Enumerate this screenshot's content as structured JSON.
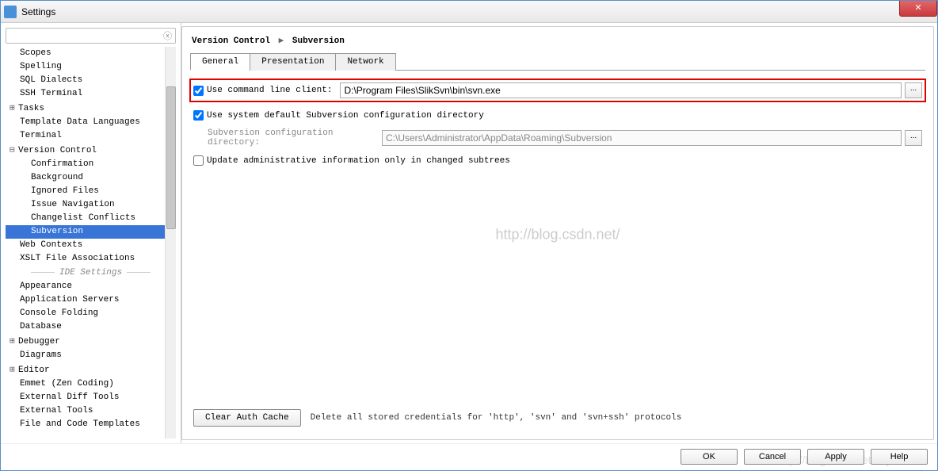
{
  "window": {
    "title": "Settings",
    "close_icon": "✕"
  },
  "search": {
    "clear_icon": "ⓧ"
  },
  "tree": {
    "items": [
      {
        "label": "Scopes",
        "level": 1
      },
      {
        "label": "Spelling",
        "level": 1
      },
      {
        "label": "SQL Dialects",
        "level": 1
      },
      {
        "label": "SSH Terminal",
        "level": 1
      },
      {
        "label": "Tasks",
        "level": 1,
        "exp": "⊞"
      },
      {
        "label": "Template Data Languages",
        "level": 1
      },
      {
        "label": "Terminal",
        "level": 1
      },
      {
        "label": "Version Control",
        "level": 1,
        "exp": "⊟"
      },
      {
        "label": "Confirmation",
        "level": 2
      },
      {
        "label": "Background",
        "level": 2
      },
      {
        "label": "Ignored Files",
        "level": 2
      },
      {
        "label": "Issue Navigation",
        "level": 2
      },
      {
        "label": "Changelist Conflicts",
        "level": 2
      },
      {
        "label": "Subversion",
        "level": 2,
        "selected": true
      },
      {
        "label": "Web Contexts",
        "level": 1
      },
      {
        "label": "XSLT File Associations",
        "level": 1
      },
      {
        "label": "IDE Settings",
        "section": true
      },
      {
        "label": "Appearance",
        "level": 1
      },
      {
        "label": "Application Servers",
        "level": 1
      },
      {
        "label": "Console Folding",
        "level": 1
      },
      {
        "label": "Database",
        "level": 1
      },
      {
        "label": "Debugger",
        "level": 1,
        "exp": "⊞"
      },
      {
        "label": "Diagrams",
        "level": 1
      },
      {
        "label": "Editor",
        "level": 1,
        "exp": "⊞"
      },
      {
        "label": "Emmet (Zen Coding)",
        "level": 1
      },
      {
        "label": "External Diff Tools",
        "level": 1
      },
      {
        "label": "External Tools",
        "level": 1
      },
      {
        "label": "File and Code Templates",
        "level": 1
      }
    ]
  },
  "breadcrumb": {
    "part1": "Version Control",
    "sep": "▶",
    "part2": "Subversion"
  },
  "tabs": [
    {
      "label": "General",
      "active": true
    },
    {
      "label": "Presentation"
    },
    {
      "label": "Network"
    }
  ],
  "general": {
    "cmdline_label": "Use command line client:",
    "cmdline_value": "D:\\Program Files\\SlikSvn\\bin\\svn.exe",
    "use_default_label": "Use system default Subversion configuration directory",
    "config_dir_label": "Subversion configuration directory:",
    "config_dir_value": "C:\\Users\\Administrator\\AppData\\Roaming\\Subversion",
    "update_admin_label": "Update administrative information only in changed subtrees",
    "clear_auth_label": "Clear Auth Cache",
    "clear_auth_hint": "Delete all stored credentials for 'http', 'svn' and 'svn+ssh' protocols",
    "dots": "..."
  },
  "watermark": "http://blog.csdn.net/",
  "footer_watermark": "http://blog.csdn.net/zhyh1986",
  "footer": {
    "ok": "OK",
    "cancel": "Cancel",
    "apply": "Apply",
    "help": "Help"
  }
}
